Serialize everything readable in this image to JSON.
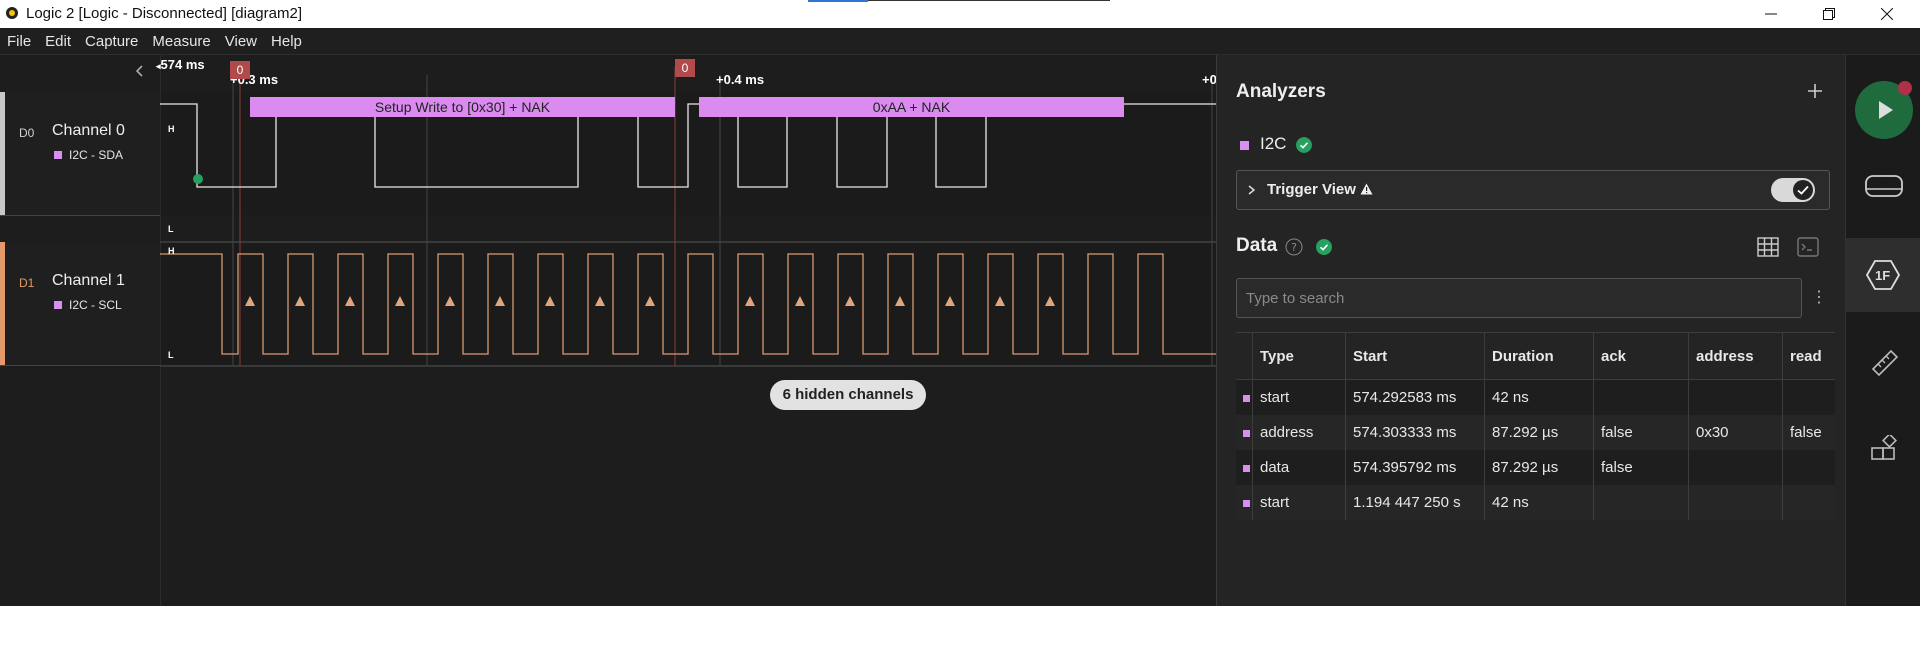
{
  "window": {
    "title": "Logic 2 [Logic - Disconnected] [diagram2]",
    "minimize_icon": "minimize-icon",
    "maximize_icon": "restore-icon",
    "close_icon": "close-icon"
  },
  "menu": [
    "File",
    "Edit",
    "Capture",
    "Measure",
    "View",
    "Help"
  ],
  "timeline": {
    "start_label": "574 ms",
    "tick_1": "+0.3 ms",
    "tick_2": "+0.4 ms",
    "tick_3": "+0",
    "marker_1": "0",
    "marker_2": "0"
  },
  "channels": [
    {
      "id": "D0",
      "name": "Channel 0",
      "analyzer": "I2C - SDA",
      "color": "#ffffff",
      "id_color": "#d0d0d0",
      "bar_color": "#c8c8c8"
    },
    {
      "id": "D1",
      "name": "Channel 1",
      "analyzer": "I2C - SCL",
      "color": "#d99a72",
      "id_color": "#e39a6a",
      "bar_color": "#e39a6a"
    }
  ],
  "level_labels": {
    "high": "H",
    "low": "L"
  },
  "protocol_frames": [
    "Setup Write to [0x30] + NAK",
    "0xAA + NAK"
  ],
  "hidden_channels": "6 hidden channels",
  "analyzers": {
    "title": "Analyzers",
    "add_icon": "plus-icon",
    "items": [
      {
        "name": "I2C",
        "status_icon": "check-circle-icon"
      }
    ],
    "trigger_view": "Trigger View"
  },
  "data_panel": {
    "title": "Data",
    "search_placeholder": "Type to search",
    "columns": [
      "Type",
      "Start",
      "Duration",
      "ack",
      "address",
      "read"
    ],
    "rows": [
      {
        "type": "start",
        "start": "574.292583 ms",
        "duration": "42 ns",
        "ack": "",
        "address": "",
        "read": ""
      },
      {
        "type": "address",
        "start": "574.303333 ms",
        "duration": "87.292 µs",
        "ack": "false",
        "address": "0x30",
        "read": "false"
      },
      {
        "type": "data",
        "start": "574.395792 ms",
        "duration": "87.292 µs",
        "ack": "false",
        "address": "",
        "read": ""
      },
      {
        "type": "start",
        "start": "1.194 447 250 s",
        "duration": "42 ns",
        "ack": "",
        "address": "",
        "read": ""
      }
    ]
  },
  "rail": {
    "items": [
      "play-icon",
      "device-icon",
      "analyzer-1f-icon",
      "ruler-icon",
      "extensions-icon"
    ],
    "analyzer_badge": "1F"
  },
  "colors": {
    "accent_green": "#27a060",
    "analyzer_purple": "#d98ff0",
    "scl_orange": "#d99a72"
  }
}
